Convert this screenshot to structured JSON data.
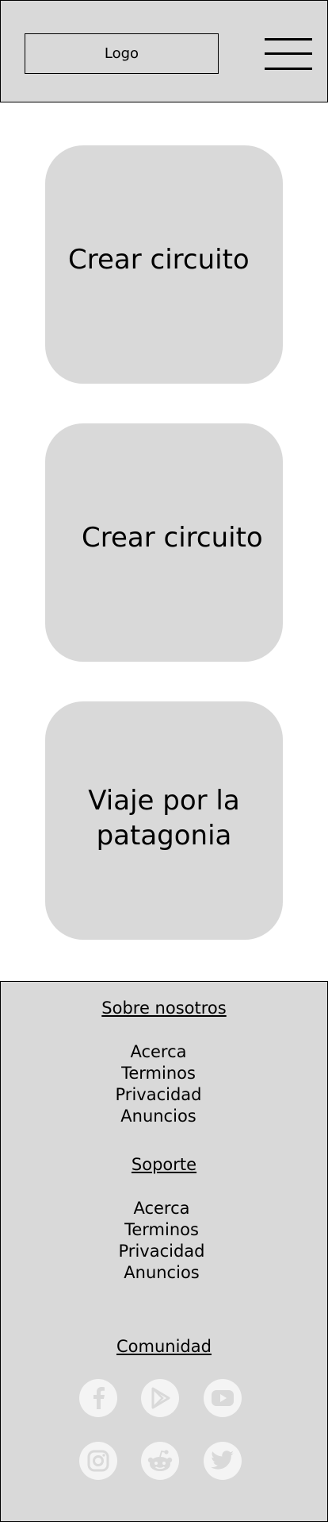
{
  "header": {
    "logo_label": "Logo",
    "menu_icon": "hamburger-menu-icon"
  },
  "cards": [
    {
      "label": "Crear circuito"
    },
    {
      "label": "Crear circuito"
    },
    {
      "label_line1": "Viaje por la",
      "label_line2": "patagonia"
    }
  ],
  "footer": {
    "about": {
      "heading": "Sobre nosotros",
      "items": [
        "Acerca",
        "Terminos",
        "Privacidad",
        "Anuncios"
      ]
    },
    "support": {
      "heading": "Soporte",
      "items": [
        "Acerca",
        "Terminos",
        "Privacidad",
        "Anuncios"
      ]
    },
    "community": {
      "heading": "Comunidad",
      "social_icons": [
        "facebook-icon",
        "google-play-icon",
        "youtube-icon",
        "instagram-icon",
        "reddit-icon",
        "twitter-icon"
      ]
    }
  },
  "colors": {
    "panel_gray": "#d9d9d9",
    "icon_circle": "#f4f4f4",
    "icon_glyph": "#d9d9d9",
    "text": "#000000"
  }
}
